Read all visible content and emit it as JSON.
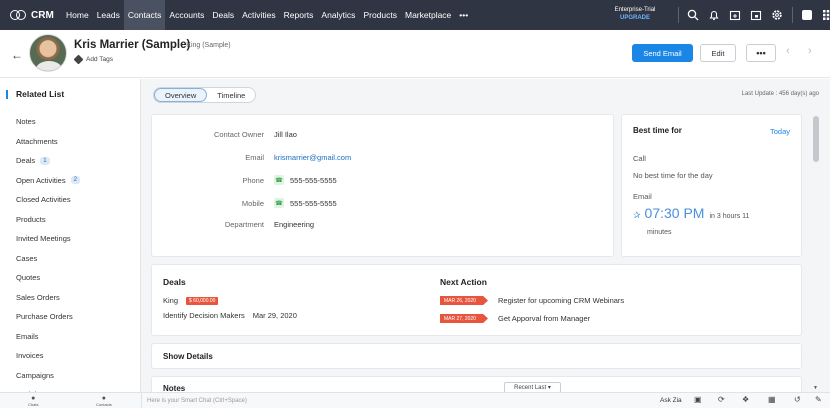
{
  "nav": {
    "brand": "CRM",
    "tabs": [
      "Home",
      "Leads",
      "Contacts",
      "Accounts",
      "Deals",
      "Activities",
      "Reports",
      "Analytics",
      "Products",
      "Marketplace",
      "•••"
    ],
    "active_tab": "Contacts",
    "trial_label": "Enterprise-Trial",
    "upgrade_label": "UPGRADE",
    "icons": [
      "search-icon",
      "bell-icon",
      "calendar-add-icon",
      "calendar-icon",
      "gear-icon",
      "user-box-icon",
      "app-grid-icon"
    ]
  },
  "header": {
    "contact_name": "Kris Marrier (Sample)",
    "account": "- King (Sample)",
    "add_tags": "Add Tags",
    "send_email": "Send Email",
    "edit": "Edit",
    "more": "•••"
  },
  "sidebar": {
    "title": "Related List",
    "items": [
      {
        "label": "Notes",
        "badge": ""
      },
      {
        "label": "Attachments",
        "badge": ""
      },
      {
        "label": "Deals",
        "badge": "1"
      },
      {
        "label": "Open Activities",
        "badge": "2"
      },
      {
        "label": "Closed Activities",
        "badge": ""
      },
      {
        "label": "Products",
        "badge": ""
      },
      {
        "label": "Invited Meetings",
        "badge": ""
      },
      {
        "label": "Cases",
        "badge": ""
      },
      {
        "label": "Quotes",
        "badge": ""
      },
      {
        "label": "Sales Orders",
        "badge": ""
      },
      {
        "label": "Purchase Orders",
        "badge": ""
      },
      {
        "label": "Emails",
        "badge": ""
      },
      {
        "label": "Invoices",
        "badge": ""
      },
      {
        "label": "Campaigns",
        "badge": ""
      },
      {
        "label": "Social",
        "badge": ""
      }
    ]
  },
  "view": {
    "tabs": [
      "Overview",
      "Timeline"
    ],
    "active": "Overview",
    "last_update": "Last Update : 456 day(s) ago"
  },
  "contact_info": [
    {
      "label": "Contact Owner",
      "value": "Jill Ilao",
      "type": "text"
    },
    {
      "label": "Email",
      "value": "krismarrier@gmail.com",
      "type": "link"
    },
    {
      "label": "Phone",
      "value": "555-555-5555",
      "type": "phone"
    },
    {
      "label": "Mobile",
      "value": "555-555-5555",
      "type": "phone"
    },
    {
      "label": "Department",
      "value": "Engineering",
      "type": "text"
    }
  ],
  "best_time": {
    "title": "Best time for",
    "today": "Today",
    "call_label": "Call",
    "call_value": "No best time for the day",
    "email_label": "Email",
    "email_time": "07:30 PM",
    "relative": "in 3 hours 11",
    "minutes": "minutes"
  },
  "deals": {
    "title": "Deals",
    "name": "King",
    "amount": "$ 60,000.00",
    "stage": "Identify Decision Makers",
    "date": "Mar 29, 2020"
  },
  "next_action": {
    "title": "Next Action",
    "items": [
      {
        "date": "MAR 26, 2020",
        "text": "Register for upcoming CRM Webinars"
      },
      {
        "date": "MAR 27, 2020",
        "text": "Get Apporval from Manager"
      }
    ]
  },
  "show_details": "Show Details",
  "notes": {
    "title": "Notes",
    "sort": "Recent Last ▾"
  },
  "bottom": {
    "chats": "Chats",
    "contacts": "Contacts",
    "smart_chat": "Here is your Smart Chat (Ctrl+Space)",
    "ask_zia": "Ask Zia"
  }
}
